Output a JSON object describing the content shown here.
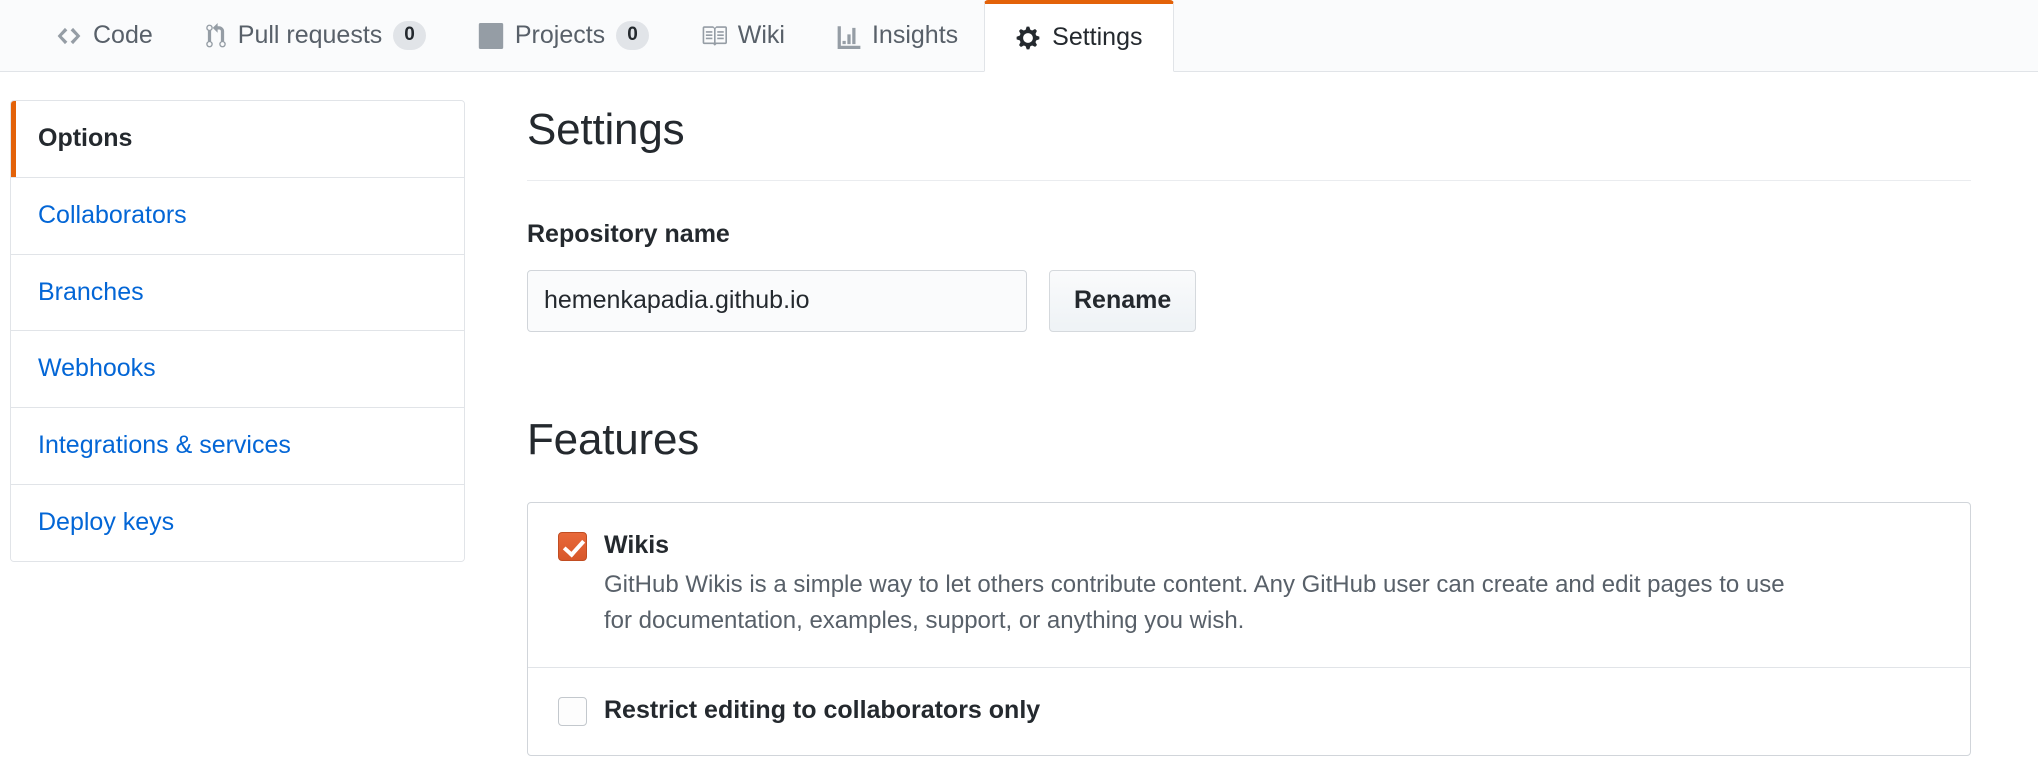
{
  "repo_nav": {
    "tabs": [
      {
        "label": "Code",
        "icon": "code-icon",
        "counter": null,
        "active": false
      },
      {
        "label": "Pull requests",
        "icon": "git-pull-request-icon",
        "counter": "0",
        "active": false
      },
      {
        "label": "Projects",
        "icon": "project-board-icon",
        "counter": "0",
        "active": false
      },
      {
        "label": "Wiki",
        "icon": "book-icon",
        "counter": null,
        "active": false
      },
      {
        "label": "Insights",
        "icon": "graph-icon",
        "counter": null,
        "active": false
      },
      {
        "label": "Settings",
        "icon": "gear-icon",
        "counter": null,
        "active": true
      }
    ]
  },
  "sidebar": {
    "items": [
      {
        "label": "Options",
        "selected": true
      },
      {
        "label": "Collaborators",
        "selected": false
      },
      {
        "label": "Branches",
        "selected": false
      },
      {
        "label": "Webhooks",
        "selected": false
      },
      {
        "label": "Integrations & services",
        "selected": false
      },
      {
        "label": "Deploy keys",
        "selected": false
      }
    ]
  },
  "main": {
    "settings_heading": "Settings",
    "repository_name": {
      "label": "Repository name",
      "value": "hemenkapadia.github.io",
      "placeholder": "Repository name",
      "rename_button": "Rename"
    },
    "features_heading": "Features",
    "features": [
      {
        "name": "wikis",
        "title": "Wikis",
        "checked": true,
        "description": "GitHub Wikis is a simple way to let others contribute content. Any GitHub user can create and edit pages to use for documentation, examples, support, or anything you wish."
      },
      {
        "name": "restrict-editing",
        "title": "Restrict editing to collaborators only",
        "checked": false,
        "description": ""
      }
    ]
  },
  "colors": {
    "accent_orange": "#e36209",
    "link_blue": "#0366d6",
    "text_dark": "#24292e",
    "text_muted": "#586069",
    "border": "#e1e4e8",
    "checkbox_checked": "#d8572a"
  }
}
